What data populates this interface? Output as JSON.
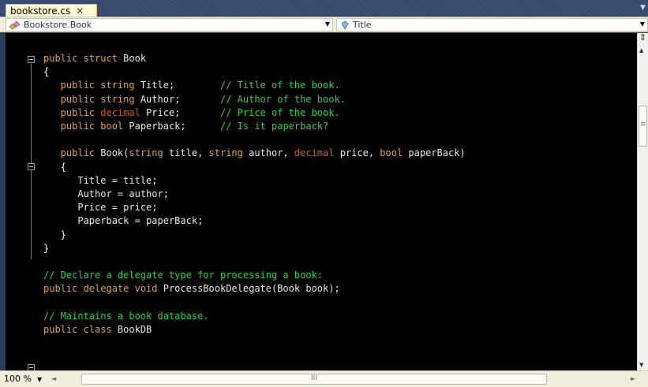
{
  "tab": {
    "title": "bookstore.cs",
    "close_glyph": "✕"
  },
  "navbar": {
    "type_combo": "Bookstore.Book",
    "member_combo": "Title"
  },
  "editor": {
    "lines": [
      [
        [
          "kw",
          "public struct "
        ],
        [
          "id",
          "Book"
        ]
      ],
      [
        [
          "pn",
          "{"
        ]
      ],
      [
        [
          "kw",
          "   public string "
        ],
        [
          "id",
          "Title;"
        ],
        [
          "pn",
          "        "
        ],
        [
          "cm",
          "// Title of the book."
        ]
      ],
      [
        [
          "kw",
          "   public string "
        ],
        [
          "id",
          "Author;"
        ],
        [
          "pn",
          "       "
        ],
        [
          "cm",
          "// Author of the book."
        ]
      ],
      [
        [
          "kw",
          "   public "
        ],
        [
          "tp",
          "decimal "
        ],
        [
          "id",
          "Price;"
        ],
        [
          "pn",
          "       "
        ],
        [
          "cm",
          "// Price of the book."
        ]
      ],
      [
        [
          "kw",
          "   public bool "
        ],
        [
          "id",
          "Paperback;"
        ],
        [
          "pn",
          "      "
        ],
        [
          "cm",
          "// Is it paperback?"
        ]
      ],
      [],
      [
        [
          "kw",
          "   public "
        ],
        [
          "id",
          "Book("
        ],
        [
          "kw",
          "string "
        ],
        [
          "id",
          "title, "
        ],
        [
          "kw",
          "string "
        ],
        [
          "id",
          "author, "
        ],
        [
          "tp",
          "decimal "
        ],
        [
          "id",
          "price, "
        ],
        [
          "kw",
          "bool "
        ],
        [
          "id",
          "paperBack)"
        ]
      ],
      [
        [
          "pn",
          "   {"
        ]
      ],
      [
        [
          "id",
          "      Title = title;"
        ]
      ],
      [
        [
          "id",
          "      Author = author;"
        ]
      ],
      [
        [
          "id",
          "      Price = price;"
        ]
      ],
      [
        [
          "id",
          "      Paperback = paperBack;"
        ]
      ],
      [
        [
          "pn",
          "   }"
        ]
      ],
      [
        [
          "pn",
          "}"
        ]
      ],
      [],
      [
        [
          "cm",
          "// Declare a delegate type for processing a book:"
        ]
      ],
      [
        [
          "kw",
          "public delegate void "
        ],
        [
          "id",
          "ProcessBookDelegate(Book book);"
        ]
      ],
      [],
      [
        [
          "cm",
          "// Maintains a book database."
        ]
      ],
      [
        [
          "kw",
          "public class "
        ],
        [
          "id",
          "BookDB"
        ]
      ]
    ]
  },
  "statusbar": {
    "zoom": "100 %",
    "hscroll_grip": "III"
  },
  "icons": {
    "tab_overflow": "chevron-down-icon",
    "class": "class-icon",
    "property": "property-icon",
    "fold": "collapse-box-icon"
  },
  "colors": {
    "keyword": "#e6a243",
    "type": "#c85f1f",
    "identifier": "#e8e8e8",
    "comment": "#2ed04c",
    "editor_bg": "#000000",
    "tab_bg": "#fff9d6"
  }
}
